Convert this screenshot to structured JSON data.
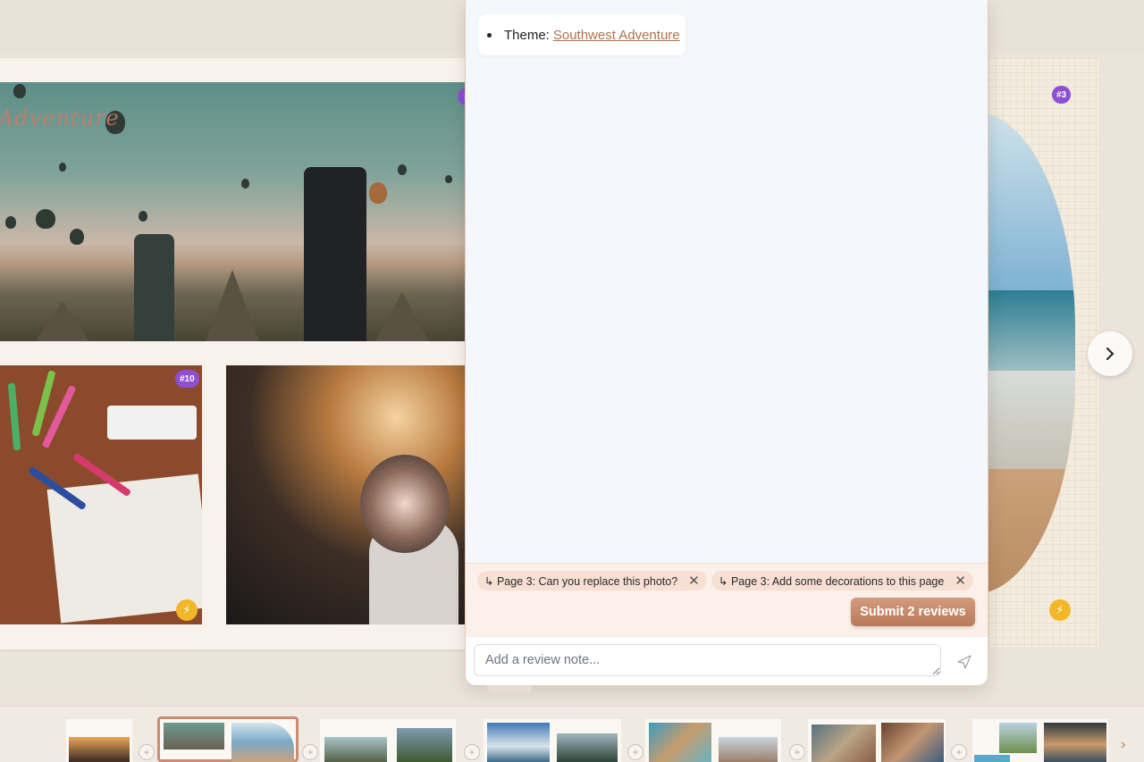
{
  "left_page": {
    "title_script": "Adventure",
    "badges": {
      "hero": "#",
      "craft": "#10",
      "wedding": "#"
    },
    "bolt_icon": "lightning-icon"
  },
  "right_page": {
    "badge": "#3"
  },
  "panel": {
    "theme_label": "Theme:",
    "theme_value": "Southwest Adventure",
    "review_chips": [
      {
        "label": "↳ Page 3: Can you replace this photo?"
      },
      {
        "label": "↳ Page 3: Add some decorations to this page"
      }
    ],
    "submit_label": "Submit 2 reviews",
    "note_placeholder": "Add a review note..."
  },
  "colors": {
    "accent": "#b9795b",
    "badge": "#8e4fd3",
    "bolt": "#f2b728",
    "link": "#b0714d"
  }
}
